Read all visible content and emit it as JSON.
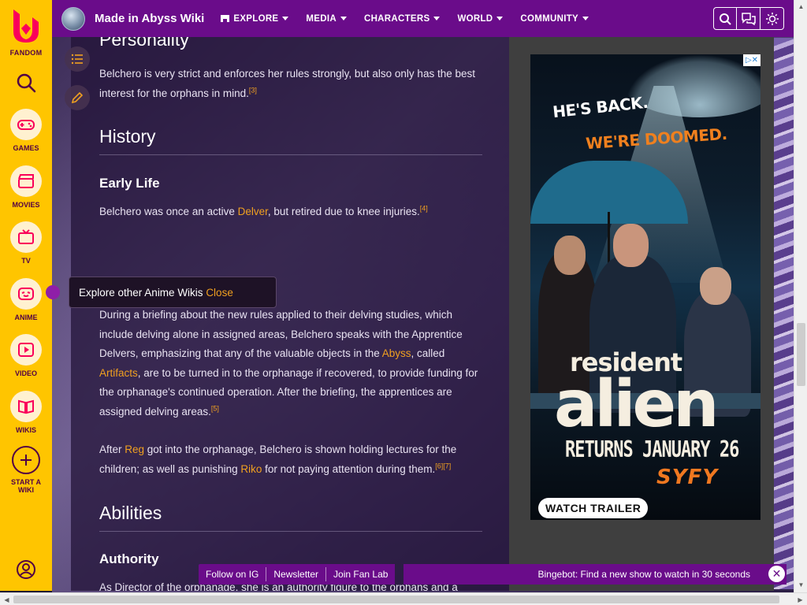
{
  "fandom": {
    "logo_label": "FANDOM",
    "rail_items": [
      {
        "label": "GAMES",
        "icon": "gamepad-icon"
      },
      {
        "label": "MOVIES",
        "icon": "clapperboard-icon"
      },
      {
        "label": "TV",
        "icon": "tv-icon"
      },
      {
        "label": "ANIME",
        "icon": "anime-face-icon"
      },
      {
        "label": "VIDEO",
        "icon": "play-icon"
      },
      {
        "label": "WIKIS",
        "icon": "book-icon"
      }
    ],
    "start_wiki_line1": "START A",
    "start_wiki_line2": "WIKI"
  },
  "topbar": {
    "wiki_name": "Made in Abyss Wiki",
    "nav": [
      "EXPLORE",
      "MEDIA",
      "CHARACTERS",
      "WORLD",
      "COMMUNITY"
    ]
  },
  "article": {
    "personality_heading": "Personality",
    "personality_text": "Belchero is very strict and enforces her rules strongly, but also only has the best interest for the orphans in mind.",
    "personality_ref": "[3]",
    "history_heading": "History",
    "early_life_heading": "Early Life",
    "early_life_pre": "Belchero was once an active ",
    "early_life_link": "Delver",
    "early_life_post": ", but retired due to knee injuries.",
    "early_life_ref": "[4]",
    "p1_a": "During a briefing about the new rules applied to their delving studies, which include delving alone in assigned areas, Belchero speaks with the Apprentice Delvers, emphasizing that any of the valuable objects in the ",
    "p1_link1": "Abyss",
    "p1_b": ", called ",
    "p1_link2": "Artifacts",
    "p1_c": ", are to be turned in to the orphanage if recovered, to provide funding for the orphanage's continued operation. After the briefing, the apprentices are assigned delving areas.",
    "p1_ref": "[5]",
    "p2_a": "After ",
    "p2_link1": "Reg",
    "p2_b": " got into the orphanage, Belchero is shown holding lectures for the children; as well as punishing ",
    "p2_link2": "Riko",
    "p2_c": " for not paying attention during them.",
    "p2_ref1": "[6]",
    "p2_ref2": "[7]",
    "abilities_heading": "Abilities",
    "authority_heading": "Authority",
    "authority_text": "As Director of the orphanage, she is an authority figure to the orphans and a"
  },
  "tooltip": {
    "text": "Explore other Anime Wikis ",
    "close": "Close"
  },
  "ad": {
    "line1": "HE'S BACK.",
    "line2": "WE'RE DOOMED.",
    "title1": "resident",
    "title2": "alien",
    "returns": "RETURNS JANUARY 26",
    "network": "SYFY",
    "cta": "WATCH TRAILER"
  },
  "fanbar": [
    "Follow on IG",
    "Newsletter",
    "Join Fan Lab"
  ],
  "bingebot": "Bingebot: Find a new show to watch in 30 seconds",
  "colors": {
    "fandom_yellow": "#ffc500",
    "community_purple": "#6a0c8a",
    "link_orange": "#f0a020"
  }
}
